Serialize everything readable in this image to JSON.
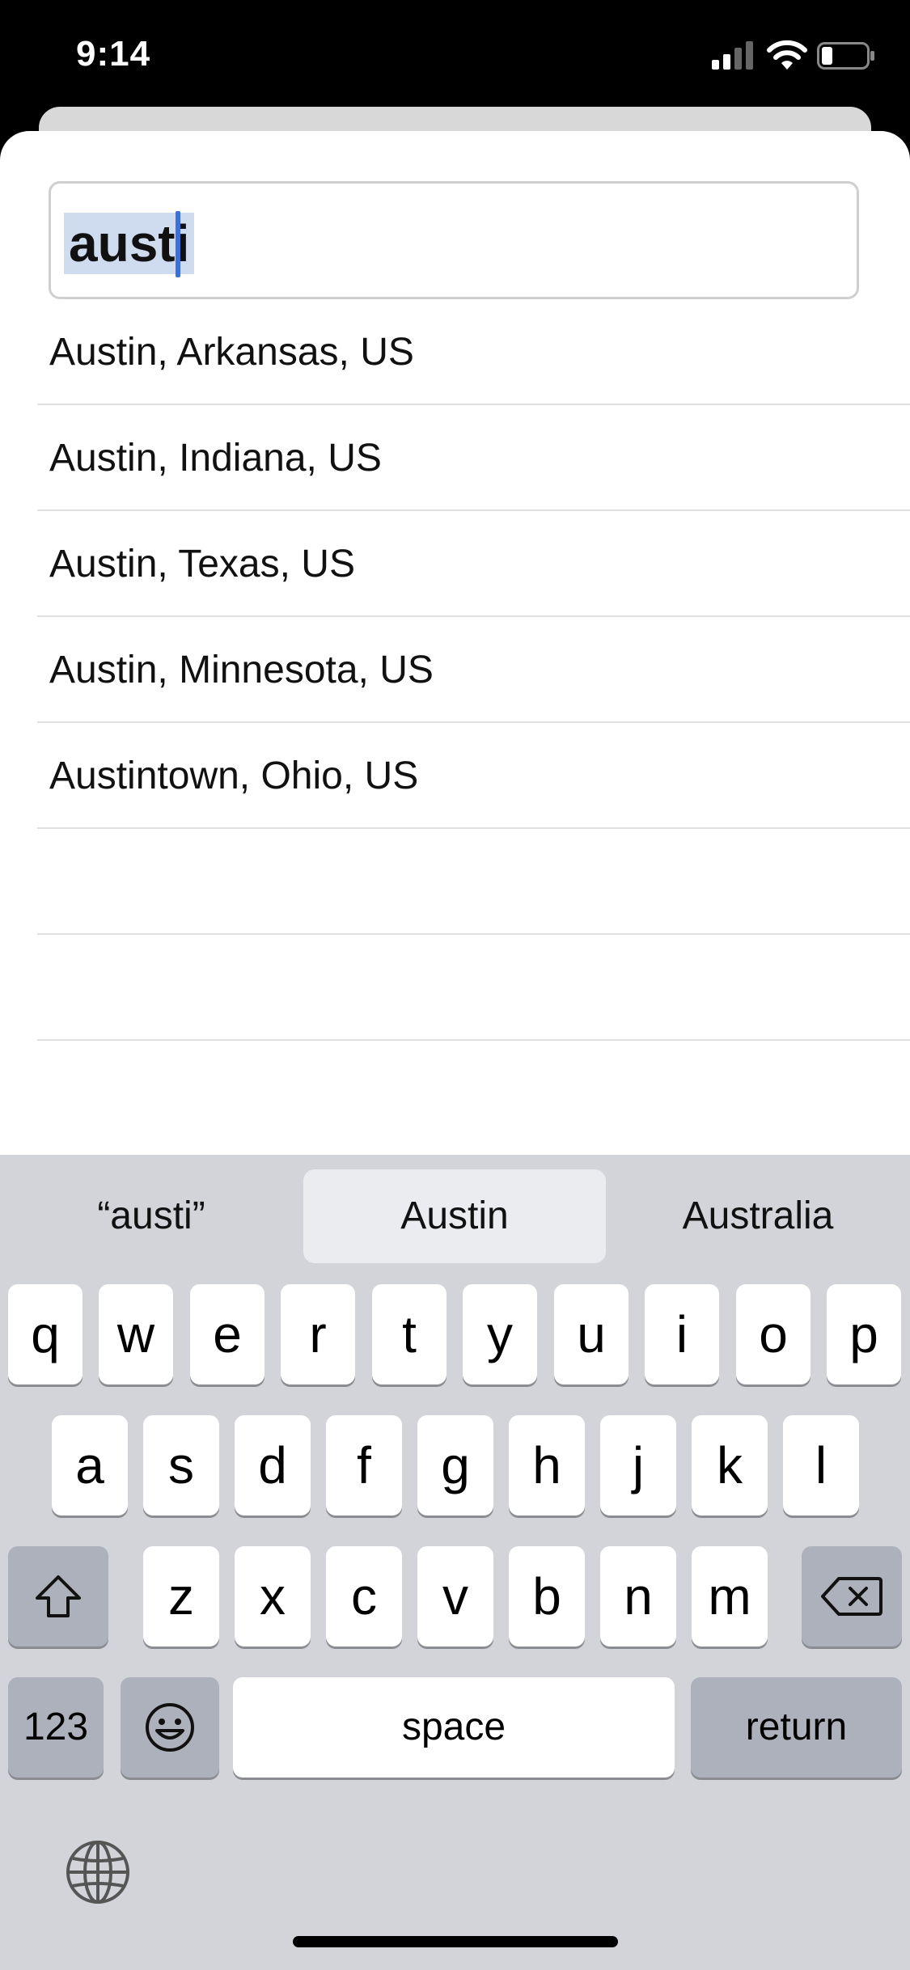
{
  "status_bar": {
    "time": "9:14"
  },
  "search": {
    "value": "austi"
  },
  "results": [
    "Austin, Arkansas, US",
    "Austin, Indiana, US",
    "Austin, Texas, US",
    "Austin, Minnesota, US",
    "Austintown, Ohio, US"
  ],
  "keyboard": {
    "suggestions": [
      "“austi”",
      "Austin",
      "Australia"
    ],
    "row1": [
      "q",
      "w",
      "e",
      "r",
      "t",
      "y",
      "u",
      "i",
      "o",
      "p"
    ],
    "row2": [
      "a",
      "s",
      "d",
      "f",
      "g",
      "h",
      "j",
      "k",
      "l"
    ],
    "row3": [
      "z",
      "x",
      "c",
      "v",
      "b",
      "n",
      "m"
    ],
    "numbers_label": "123",
    "space_label": "space",
    "return_label": "return"
  },
  "icons": {
    "signal": "cellular-signal-icon",
    "wifi": "wifi-icon",
    "battery": "battery-icon",
    "shift": "shift-icon",
    "delete": "delete-icon",
    "emoji": "emoji-icon",
    "globe": "globe-icon"
  }
}
